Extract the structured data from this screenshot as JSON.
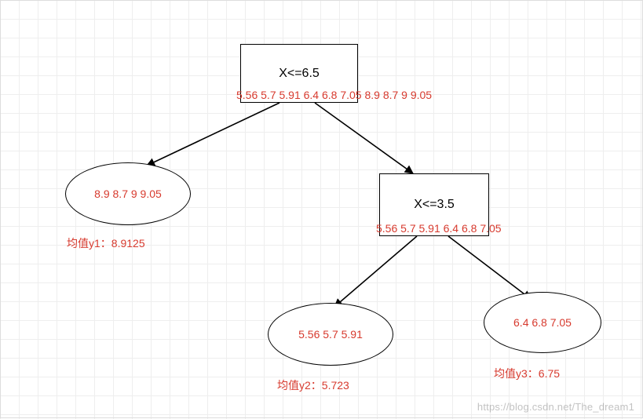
{
  "diagram": {
    "root": {
      "condition": "X<=6.5",
      "values": "5.56  5.7  5.91  6.4  6.8  7.05  8.9  8.7  9  9.05"
    },
    "leftLeaf": {
      "values": "8.9  8.7  9  9.05",
      "mean": "均值y1：8.9125"
    },
    "rightNode": {
      "condition": "X<=3.5",
      "values": "5.56  5.7  5.91  6.4  6.8  7.05"
    },
    "leaf2": {
      "values": "5.56  5.7  5.91",
      "mean": "均值y2：5.723"
    },
    "leaf3": {
      "values": "6.4  6.8  7.05",
      "mean": "均值y3：6.75"
    }
  },
  "watermark": "https://blog.csdn.net/The_dream1",
  "chart_data": {
    "type": "table",
    "description": "Decision / regression tree with two internal splits and three leaves",
    "nodes": [
      {
        "id": "root",
        "kind": "split",
        "condition": "X <= 6.5",
        "samples": [
          5.56,
          5.7,
          5.91,
          6.4,
          6.8,
          7.05,
          8.9,
          8.7,
          9,
          9.05
        ]
      },
      {
        "id": "leftLeaf",
        "kind": "leaf",
        "samples": [
          8.9,
          8.7,
          9,
          9.05
        ],
        "mean_label": "y1",
        "mean": 8.9125
      },
      {
        "id": "rightNode",
        "kind": "split",
        "condition": "X <= 3.5",
        "samples": [
          5.56,
          5.7,
          5.91,
          6.4,
          6.8,
          7.05
        ]
      },
      {
        "id": "leaf2",
        "kind": "leaf",
        "samples": [
          5.56,
          5.7,
          5.91
        ],
        "mean_label": "y2",
        "mean": 5.723
      },
      {
        "id": "leaf3",
        "kind": "leaf",
        "samples": [
          6.4,
          6.8,
          7.05
        ],
        "mean_label": "y3",
        "mean": 6.75
      }
    ],
    "edges": [
      {
        "from": "root",
        "to": "leftLeaf"
      },
      {
        "from": "root",
        "to": "rightNode"
      },
      {
        "from": "rightNode",
        "to": "leaf2"
      },
      {
        "from": "rightNode",
        "to": "leaf3"
      }
    ]
  }
}
